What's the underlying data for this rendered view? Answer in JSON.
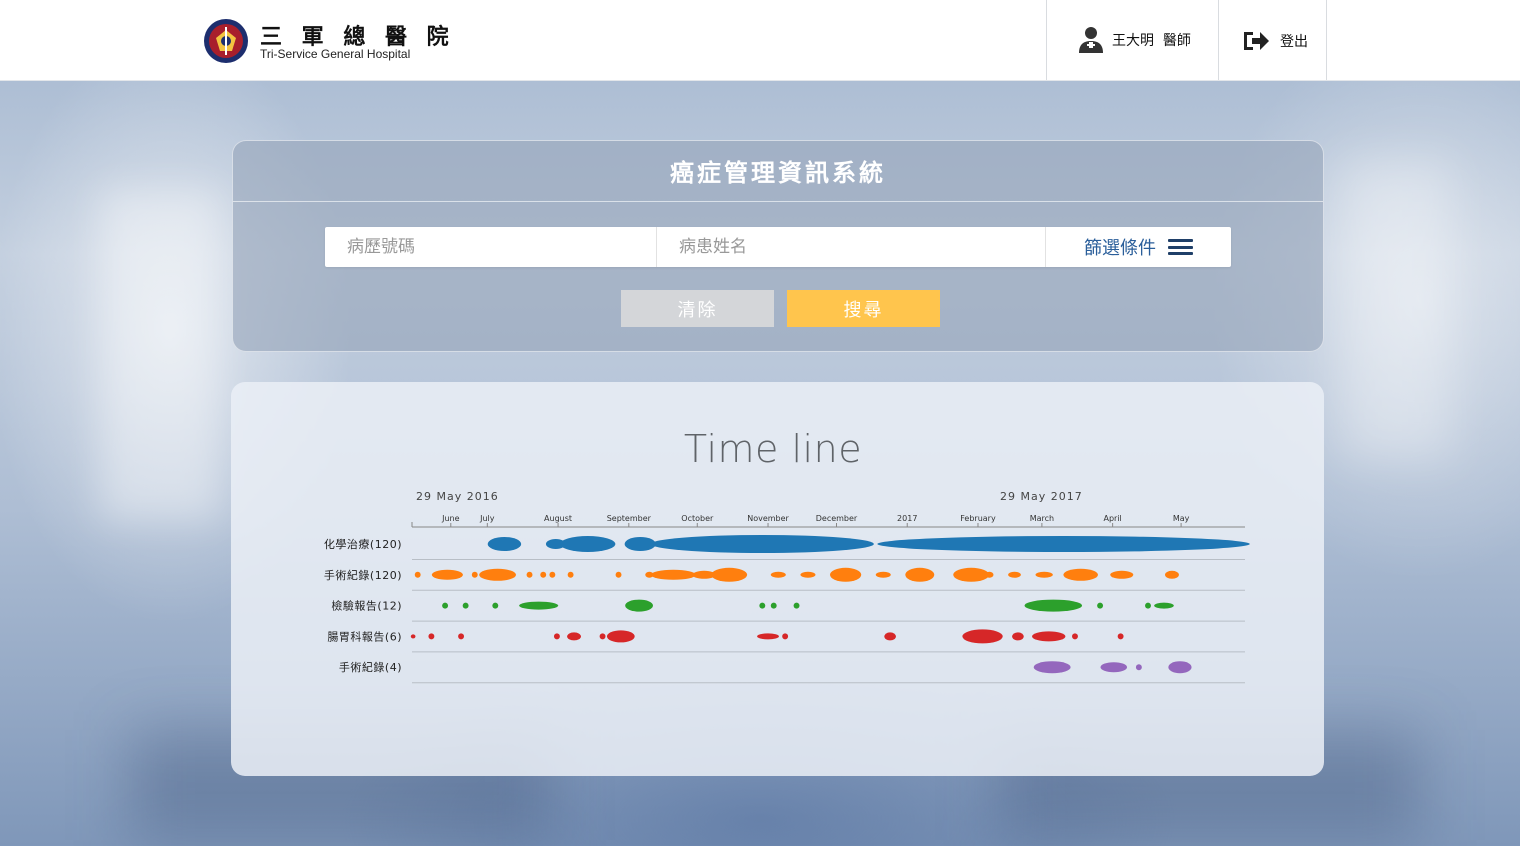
{
  "header": {
    "brand_cn": "三 軍 總 醫 院",
    "brand_en": "Tri-Service General Hospital",
    "user_label": "王大明  醫師",
    "logout_label": "登出"
  },
  "search": {
    "title": "癌症管理資訊系統",
    "mrn_placeholder": "病歷號碼",
    "name_placeholder": "病患姓名",
    "mrn_value": "",
    "name_value": "",
    "filter_label": "篩選條件",
    "clear_label": "清除",
    "search_label": "搜尋"
  },
  "timeline": {
    "title": "Time line",
    "start_date_label": "29 May 2016",
    "mid_date_label": "29 May 2017"
  },
  "colors": {
    "accent_yellow": "#ffc54d",
    "clear_gray": "#d4d6d9",
    "filter_blue": "#2a5e9a",
    "series_blue": "#1f77b4",
    "series_orange": "#ff7f0e",
    "series_green": "#2ca02c",
    "series_red": "#d62728",
    "series_purple": "#9467bd"
  },
  "chart_data": {
    "type": "timeline",
    "x_range": [
      "2016-05-29",
      "2017-05-29"
    ],
    "x_ticks": [
      {
        "date": "2016-06-15",
        "label": "June"
      },
      {
        "date": "2016-07-01",
        "label": "July"
      },
      {
        "date": "2016-08-01",
        "label": "August"
      },
      {
        "date": "2016-09-01",
        "label": "September"
      },
      {
        "date": "2016-10-01",
        "label": "October"
      },
      {
        "date": "2016-11-01",
        "label": "November"
      },
      {
        "date": "2016-12-01",
        "label": "December"
      },
      {
        "date": "2017-01-01",
        "label": "2017"
      },
      {
        "date": "2017-02-01",
        "label": "February"
      },
      {
        "date": "2017-03-01",
        "label": "March"
      },
      {
        "date": "2017-04-01",
        "label": "April"
      },
      {
        "date": "2017-05-01",
        "label": "May"
      }
    ],
    "rows": [
      {
        "label": "化學治療(120)",
        "color": "#1f77b4",
        "events": [
          {
            "start": "2016-07-03",
            "end": "2016-07-14",
            "size": 7
          },
          {
            "start": "2016-07-28",
            "end": "2016-08-03",
            "size": 5
          },
          {
            "start": "2016-08-04",
            "end": "2016-08-24",
            "size": 8
          },
          {
            "start": "2016-09-01",
            "end": "2016-09-11",
            "size": 7
          },
          {
            "start": "2016-09-13",
            "end": "2016-12-15",
            "size": 9
          },
          {
            "start": "2016-12-21",
            "end": "2017-05-29",
            "size": 8
          }
        ]
      },
      {
        "label": "手術紀錄(120)",
        "color": "#ff7f0e",
        "events": [
          {
            "start": "2016-05-31",
            "end": "2016-06-01",
            "size": 3
          },
          {
            "start": "2016-06-08",
            "end": "2016-06-19",
            "size": 5
          },
          {
            "start": "2016-06-25",
            "end": "2016-06-26",
            "size": 3
          },
          {
            "start": "2016-06-29",
            "end": "2016-07-12",
            "size": 6
          },
          {
            "start": "2016-07-19",
            "end": "2016-07-20",
            "size": 3
          },
          {
            "start": "2016-07-25",
            "end": "2016-07-26",
            "size": 3
          },
          {
            "start": "2016-07-29",
            "end": "2016-07-30",
            "size": 3
          },
          {
            "start": "2016-08-06",
            "end": "2016-08-07",
            "size": 3
          },
          {
            "start": "2016-08-27",
            "end": "2016-08-28",
            "size": 3
          },
          {
            "start": "2016-09-09",
            "end": "2016-09-11",
            "size": 3
          },
          {
            "start": "2016-09-12",
            "end": "2016-09-29",
            "size": 5
          },
          {
            "start": "2016-09-30",
            "end": "2016-10-08",
            "size": 4
          },
          {
            "start": "2016-10-09",
            "end": "2016-10-21",
            "size": 7
          },
          {
            "start": "2016-11-03",
            "end": "2016-11-08",
            "size": 3
          },
          {
            "start": "2016-11-16",
            "end": "2016-11-21",
            "size": 3
          },
          {
            "start": "2016-11-30",
            "end": "2016-12-10",
            "size": 7
          },
          {
            "start": "2016-12-19",
            "end": "2016-12-24",
            "size": 3
          },
          {
            "start": "2017-01-02",
            "end": "2017-01-11",
            "size": 7
          },
          {
            "start": "2017-01-23",
            "end": "2017-02-04",
            "size": 7
          },
          {
            "start": "2017-02-05",
            "end": "2017-02-07",
            "size": 3
          },
          {
            "start": "2017-02-15",
            "end": "2017-02-19",
            "size": 3
          },
          {
            "start": "2017-02-27",
            "end": "2017-03-05",
            "size": 3
          },
          {
            "start": "2017-03-12",
            "end": "2017-03-24",
            "size": 6
          },
          {
            "start": "2017-04-01",
            "end": "2017-04-09",
            "size": 4
          },
          {
            "start": "2017-04-25",
            "end": "2017-04-29",
            "size": 4
          }
        ]
      },
      {
        "label": "檢驗報告(12)",
        "color": "#2ca02c",
        "events": [
          {
            "start": "2016-06-12",
            "end": "2016-06-13",
            "size": 3
          },
          {
            "start": "2016-06-21",
            "end": "2016-06-22",
            "size": 3
          },
          {
            "start": "2016-07-04",
            "end": "2016-07-05",
            "size": 3
          },
          {
            "start": "2016-07-16",
            "end": "2016-07-31",
            "size": 4
          },
          {
            "start": "2016-09-01",
            "end": "2016-09-10",
            "size": 6
          },
          {
            "start": "2016-10-29",
            "end": "2016-10-30",
            "size": 3
          },
          {
            "start": "2016-11-03",
            "end": "2016-11-04",
            "size": 3
          },
          {
            "start": "2016-11-13",
            "end": "2016-11-14",
            "size": 3
          },
          {
            "start": "2017-02-23",
            "end": "2017-03-17",
            "size": 6
          },
          {
            "start": "2017-03-26",
            "end": "2017-03-27",
            "size": 3
          },
          {
            "start": "2017-04-16",
            "end": "2017-04-17",
            "size": 3
          },
          {
            "start": "2017-04-20",
            "end": "2017-04-27",
            "size": 3
          }
        ]
      },
      {
        "label": "腸胃科報告(6)",
        "color": "#d62728",
        "events": [
          {
            "start": "2016-05-29",
            "end": "2016-05-30",
            "size": 2
          },
          {
            "start": "2016-06-06",
            "end": "2016-06-07",
            "size": 3
          },
          {
            "start": "2016-06-19",
            "end": "2016-06-20",
            "size": 3
          },
          {
            "start": "2016-07-31",
            "end": "2016-08-01",
            "size": 3
          },
          {
            "start": "2016-08-06",
            "end": "2016-08-10",
            "size": 4
          },
          {
            "start": "2016-08-20",
            "end": "2016-08-21",
            "size": 3
          },
          {
            "start": "2016-08-24",
            "end": "2016-09-02",
            "size": 6
          },
          {
            "start": "2016-10-28",
            "end": "2016-11-05",
            "size": 3
          },
          {
            "start": "2016-11-08",
            "end": "2016-11-09",
            "size": 3
          },
          {
            "start": "2016-12-23",
            "end": "2016-12-26",
            "size": 4
          },
          {
            "start": "2017-01-27",
            "end": "2017-02-10",
            "size": 7
          },
          {
            "start": "2017-02-17",
            "end": "2017-02-20",
            "size": 4
          },
          {
            "start": "2017-02-26",
            "end": "2017-03-10",
            "size": 5
          },
          {
            "start": "2017-03-15",
            "end": "2017-03-16",
            "size": 3
          },
          {
            "start": "2017-04-04",
            "end": "2017-04-05",
            "size": 3
          }
        ]
      },
      {
        "label": "手術紀錄(4)",
        "color": "#9467bd",
        "events": [
          {
            "start": "2017-02-27",
            "end": "2017-03-12",
            "size": 6
          },
          {
            "start": "2017-03-28",
            "end": "2017-04-06",
            "size": 5
          },
          {
            "start": "2017-04-12",
            "end": "2017-04-13",
            "size": 3
          },
          {
            "start": "2017-04-27",
            "end": "2017-05-04",
            "size": 6
          }
        ]
      }
    ]
  }
}
